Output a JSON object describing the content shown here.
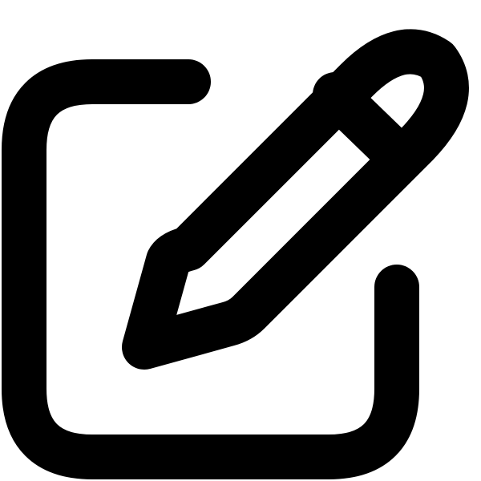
{
  "icon": {
    "name": "edit-icon",
    "color": "#000000",
    "background": "#ffffff"
  }
}
